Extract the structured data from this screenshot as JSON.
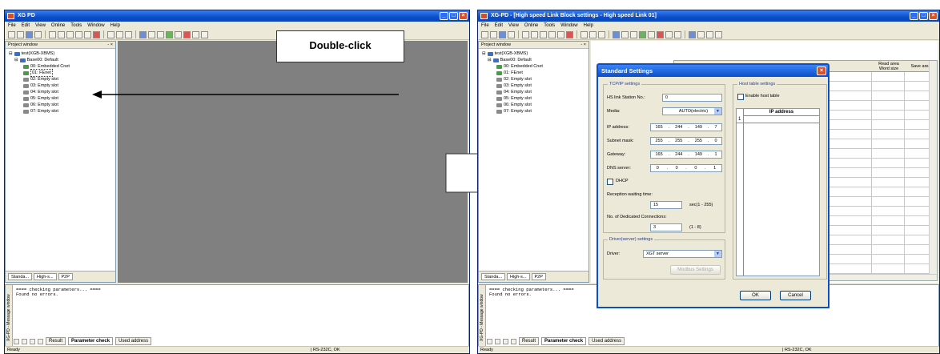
{
  "left_window": {
    "title": "XG PD",
    "menu": [
      "File",
      "Edit",
      "View",
      "Online",
      "Tools",
      "Window",
      "Help"
    ],
    "project_pane": {
      "title": "Project window",
      "tree": [
        {
          "label": "test(XGB-XBMS)",
          "level": 0,
          "icon": "plc-icon"
        },
        {
          "label": "Base00: Default",
          "level": 1,
          "icon": "base-icon"
        },
        {
          "label": "00: Embedded Cnet",
          "level": 2,
          "icon": "network-icon"
        },
        {
          "label": "01: FEnet",
          "level": 2,
          "icon": "network-icon",
          "selected": true
        },
        {
          "label": "02: Empty slot",
          "level": 2,
          "icon": "slot-icon"
        },
        {
          "label": "03: Empty slot",
          "level": 2,
          "icon": "slot-icon"
        },
        {
          "label": "04: Empty slot",
          "level": 2,
          "icon": "slot-icon"
        },
        {
          "label": "05: Empty slot",
          "level": 2,
          "icon": "slot-icon"
        },
        {
          "label": "06: Empty slot",
          "level": 2,
          "icon": "slot-icon"
        },
        {
          "label": "07: Empty slot",
          "level": 2,
          "icon": "slot-icon"
        }
      ],
      "tabs": [
        "Standa...",
        "High-s...",
        "P2P"
      ]
    },
    "messages": [
      "==== checking parameters... ====",
      "Found no errors."
    ],
    "message_side_label": "XG-PD - Message window",
    "message_tabs": [
      "Result",
      "Parameter check",
      "Used address"
    ],
    "status_left": "Ready",
    "status_conn": "| RS-232C, OK"
  },
  "callout": "Double-click",
  "right_window": {
    "title": "XG-PD - [High speed Link Block settings - High speed Link 01]",
    "grid_headers": {
      "read_area": "Read area",
      "word_size": "Word size",
      "save_area": "Save area"
    },
    "status_left": "Ready",
    "status_conn": "| RS-232C, OK"
  },
  "dialog": {
    "title": "Standard Settings",
    "tcpip_group": "TCP/IP settings",
    "hs_station_label": "HS link Station No.:",
    "hs_station_value": "0",
    "media_label": "Media:",
    "media_value": "AUTO(electric)",
    "ip_label": "IP address:",
    "ip_value": [
      "165",
      "244",
      "149",
      "7"
    ],
    "subnet_label": "Subnet mask:",
    "subnet_value": [
      "255",
      "255",
      "255",
      "0"
    ],
    "gateway_label": "Gateway:",
    "gateway_value": [
      "165",
      "244",
      "149",
      "1"
    ],
    "dns_label": "DNS server:",
    "dns_value": [
      "0",
      "0",
      "0",
      "1"
    ],
    "dhcp_label": "DHCP",
    "reception_label": "Reception waiting time:",
    "reception_value": "15",
    "reception_unit": "sec(1 - 255)",
    "dedicated_label": "No. of Dedicated Connections:",
    "dedicated_value": "3",
    "dedicated_range": "(1 - 8)",
    "driver_group": "Driver(server) settings",
    "driver_label": "Driver:",
    "driver_value": "XGT server",
    "modbus_button": "Modbus Settings",
    "host_group": "Host table settings",
    "enable_host_label": "Enable host table",
    "ip_col_header": "IP address",
    "ip_row1": "1",
    "ok_button": "OK",
    "cancel_button": "Cancel"
  }
}
